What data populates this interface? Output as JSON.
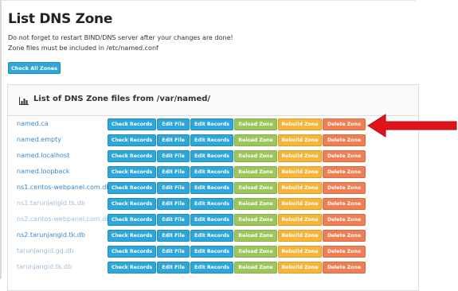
{
  "page": {
    "title": "List DNS Zone",
    "notice_line1": "Do not forget to restart BIND/DNS server after your changes are done!",
    "notice_line2": "Zone files must be included in /etc/named.conf",
    "check_all_label": "Check All Zones"
  },
  "panel": {
    "icon": "bar-chart-icon",
    "title": "List of DNS Zone files from /var/named/"
  },
  "actions": {
    "check_records": "Check Records",
    "edit_file": "Edit File",
    "edit_records": "Edit Records",
    "reload_zone": "Reload Zone",
    "rebuild_zone": "Rebuild Zone",
    "delete_zone": "Delete Zone"
  },
  "zones": [
    {
      "name": "named.ca"
    },
    {
      "name": "named.empty"
    },
    {
      "name": "named.localhost"
    },
    {
      "name": "named.loopback"
    },
    {
      "name": "ns1.centos-webpanel.com.db"
    },
    {
      "name": "ns1.tarunjangid.tk.db"
    },
    {
      "name": "ns2.centos-webpanel.com.db"
    },
    {
      "name": "ns2.tarunjangid.tk.db"
    },
    {
      "name": "tarunjangid.gq.db"
    },
    {
      "name": "tarunjangid.tk.db"
    }
  ],
  "colors": {
    "info_button": "#2ea6d8",
    "reload_button": "#9cc65b",
    "rebuild_button": "#f5b43a",
    "delete_button": "#ef7e55",
    "annotation_arrow": "#e0131b"
  },
  "annotation": {
    "icon": "red-arrow-icon"
  }
}
